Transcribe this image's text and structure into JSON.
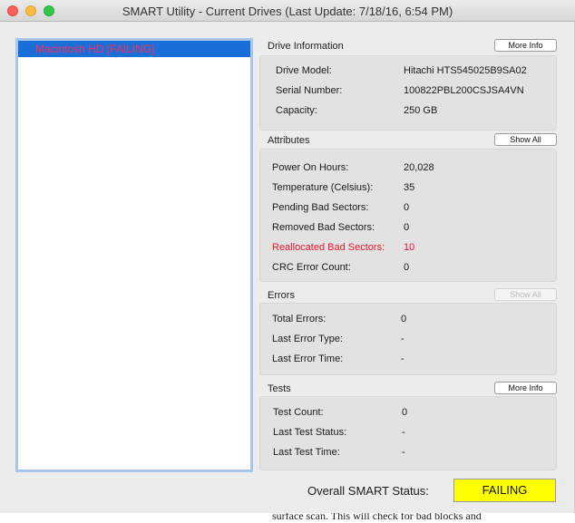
{
  "window": {
    "title": "SMART Utility - Current Drives (Last Update: 7/18/16, 6:54 PM)"
  },
  "drives": [
    {
      "label": "Macintosh HD  [FAILING]"
    }
  ],
  "drive_info": {
    "heading": "Drive Information",
    "button": "More Info",
    "rows": [
      {
        "label": "Drive Model:",
        "value": "Hitachi HTS545025B9SA02"
      },
      {
        "label": "Serial Number:",
        "value": "100822PBL200CSJSA4VN"
      },
      {
        "label": "Capacity:",
        "value": "250 GB"
      }
    ]
  },
  "attributes": {
    "heading": "Attributes",
    "button": "Show All",
    "rows": [
      {
        "label": "Power On Hours:",
        "value": "20,028"
      },
      {
        "label": "Temperature (Celsius):",
        "value": "35"
      },
      {
        "label": "Pending Bad Sectors:",
        "value": "0"
      },
      {
        "label": "Removed Bad Sectors:",
        "value": "0"
      },
      {
        "label": "Reallocated Bad Sectors:",
        "value": "10"
      },
      {
        "label": "CRC Error Count:",
        "value": "0"
      }
    ]
  },
  "errors": {
    "heading": "Errors",
    "button": "Show All",
    "rows": [
      {
        "label": "Total Errors:",
        "value": "0"
      },
      {
        "label": "Last Error Type:",
        "value": "-"
      },
      {
        "label": "Last Error Time:",
        "value": "-"
      }
    ]
  },
  "tests": {
    "heading": "Tests",
    "button": "More Info",
    "rows": [
      {
        "label": "Test Count:",
        "value": "0"
      },
      {
        "label": "Last Test Status:",
        "value": "-"
      },
      {
        "label": "Last Test Time:",
        "value": "-"
      }
    ]
  },
  "overall": {
    "label": "Overall SMART Status:",
    "value": "FAILING",
    "color": "#ffff00"
  },
  "background_text": "surface scan. This will check for bad blocks and",
  "colors": {
    "selection": "#1a6ed8",
    "failing_text": "#ff2d5a",
    "warning": "#e8172e"
  }
}
